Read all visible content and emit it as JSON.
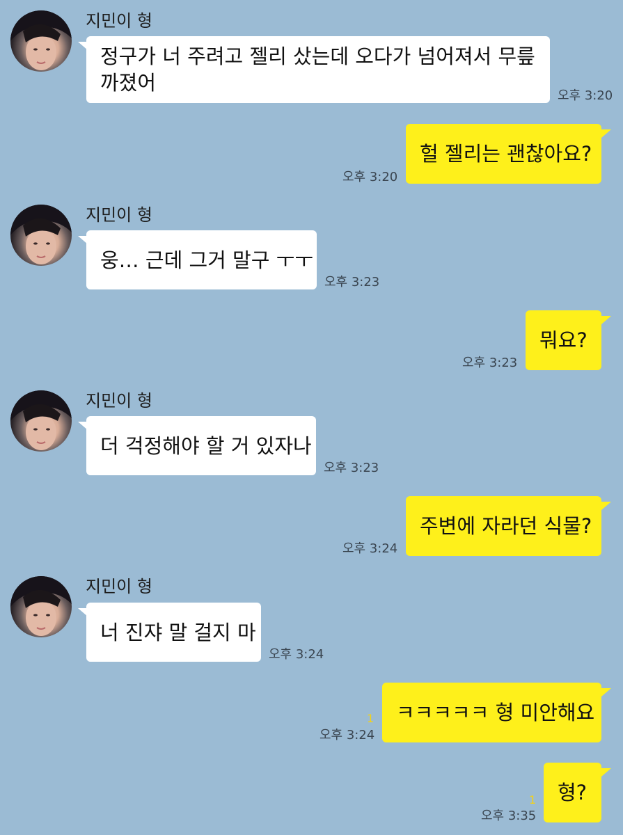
{
  "contact_name": "지민이 형",
  "messages": [
    {
      "side": "in",
      "text": "정구가 너 주려고 젤리 샀는데 오다가 넘어져서 무릎 까졌어",
      "time": "오후 3:20"
    },
    {
      "side": "out",
      "text": "헐 젤리는 괜찮아요?",
      "time": "오후 3:20"
    },
    {
      "side": "in",
      "text": "웅… 근데 그거 말구 ㅜㅜ",
      "time": "오후 3:23"
    },
    {
      "side": "out",
      "text": "뭐요?",
      "time": "오후 3:23"
    },
    {
      "side": "in",
      "text": "더 걱정해야 할 거 있자나",
      "time": "오후 3:23"
    },
    {
      "side": "out",
      "text": "주변에 자라던 식물?",
      "time": "오후 3:24"
    },
    {
      "side": "in",
      "text": "너 진쟈 말 걸지 마",
      "time": "오후 3:24"
    },
    {
      "side": "out",
      "text": "ㅋㅋㅋㅋㅋ 형 미안해요",
      "time": "오후 3:24",
      "unread": "1"
    },
    {
      "side": "out",
      "text": "형?",
      "time": "오후 3:35",
      "unread": "1"
    }
  ],
  "colors": {
    "background": "#9bbbd4",
    "incoming_bubble": "#ffffff",
    "outgoing_bubble": "#fef01b",
    "unread_count": "#f4d217"
  },
  "icons": {
    "avatar": "profile-photo-avatar"
  }
}
